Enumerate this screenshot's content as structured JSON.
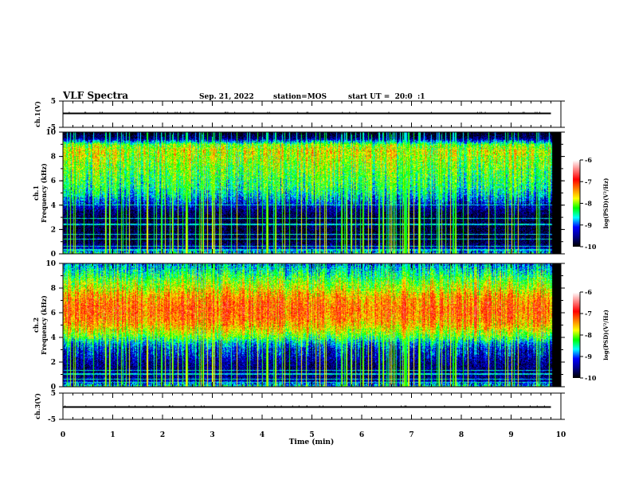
{
  "header": {
    "title": "VLF Spectra",
    "date": "Sep. 21, 2022",
    "station": "station=MOS",
    "start": "start UT =  20:0  :1"
  },
  "chart_data": {
    "type": "heatmap",
    "x": {
      "label": "Time (min)",
      "range": [
        0,
        10
      ],
      "ticks": [
        "0",
        "1",
        "2",
        "3",
        "4",
        "5",
        "6",
        "7",
        "8",
        "9",
        "10"
      ],
      "data_end": 9.8
    },
    "panels": [
      {
        "id": "ch1_waveform",
        "type": "line",
        "ylabel": "ch.1(V)",
        "ylim": [
          -5,
          5
        ],
        "ticks": [
          "5",
          "-5"
        ],
        "level": 0.3
      },
      {
        "id": "ch1_spectrogram",
        "type": "heatmap",
        "ylabel_channel": "ch.1",
        "ylabel": "Frequency (kHz)",
        "ylim": [
          0,
          10
        ],
        "ticks": [
          "0",
          "2",
          "4",
          "6",
          "8",
          "10"
        ],
        "freq_khz": [
          0,
          0.5,
          1,
          1.5,
          2,
          2.5,
          3,
          3.5,
          4,
          4.5,
          5,
          5.5,
          6,
          6.5,
          7,
          7.5,
          8,
          8.5,
          9,
          9.5,
          10
        ],
        "mean_log_psd": [
          -8.6,
          -9.5,
          -9.8,
          -9.8,
          -9.8,
          -9.8,
          -9.8,
          -9.6,
          -9.3,
          -8.9,
          -8.6,
          -8.4,
          -8.3,
          -8.2,
          -8.1,
          -8.0,
          -7.9,
          -7.8,
          -8.1,
          -9.6,
          -10
        ],
        "line_freqs_khz": [
          0.3,
          0.6,
          1.2,
          1.6,
          2.4,
          2.9,
          4.0
        ]
      },
      {
        "id": "ch2_spectrogram",
        "type": "heatmap",
        "ylabel_channel": "ch.2",
        "ylabel": "Frequency (kHz)",
        "ylim": [
          0,
          10
        ],
        "ticks": [
          "0",
          "2",
          "4",
          "6",
          "8",
          "10"
        ],
        "freq_khz": [
          0,
          0.5,
          1,
          1.5,
          2,
          2.5,
          3,
          3.5,
          4,
          4.5,
          5,
          5.5,
          6,
          6.5,
          7,
          7.5,
          8,
          8.5,
          9,
          9.5,
          10
        ],
        "mean_log_psd": [
          -8.6,
          -9.5,
          -9.6,
          -9.6,
          -9.5,
          -9.3,
          -9.2,
          -8.8,
          -8.2,
          -7.8,
          -7.5,
          -7.3,
          -7.2,
          -7.2,
          -7.3,
          -7.5,
          -7.8,
          -8.0,
          -8.3,
          -8.6,
          -8.9
        ],
        "line_freqs_khz": [
          0.3,
          0.6,
          1.0,
          1.3
        ]
      },
      {
        "id": "ch3_waveform",
        "type": "line",
        "ylabel": "ch.3(V)",
        "ylim": [
          -5,
          5
        ],
        "ticks": [
          "5",
          "-5"
        ],
        "level": -0.3
      }
    ],
    "colorbar": {
      "label": "log(PSD)(V²/Hz)",
      "range": [
        -10,
        -6
      ],
      "ticks": [
        "-6",
        "-7",
        "-8",
        "-9",
        "-10"
      ],
      "colormap": [
        "#000000",
        "#00008b",
        "#0000ff",
        "#00ffff",
        "#00ff00",
        "#ffff00",
        "#ff8000",
        "#ff0000",
        "#ff8080",
        "#ffffff"
      ]
    }
  }
}
